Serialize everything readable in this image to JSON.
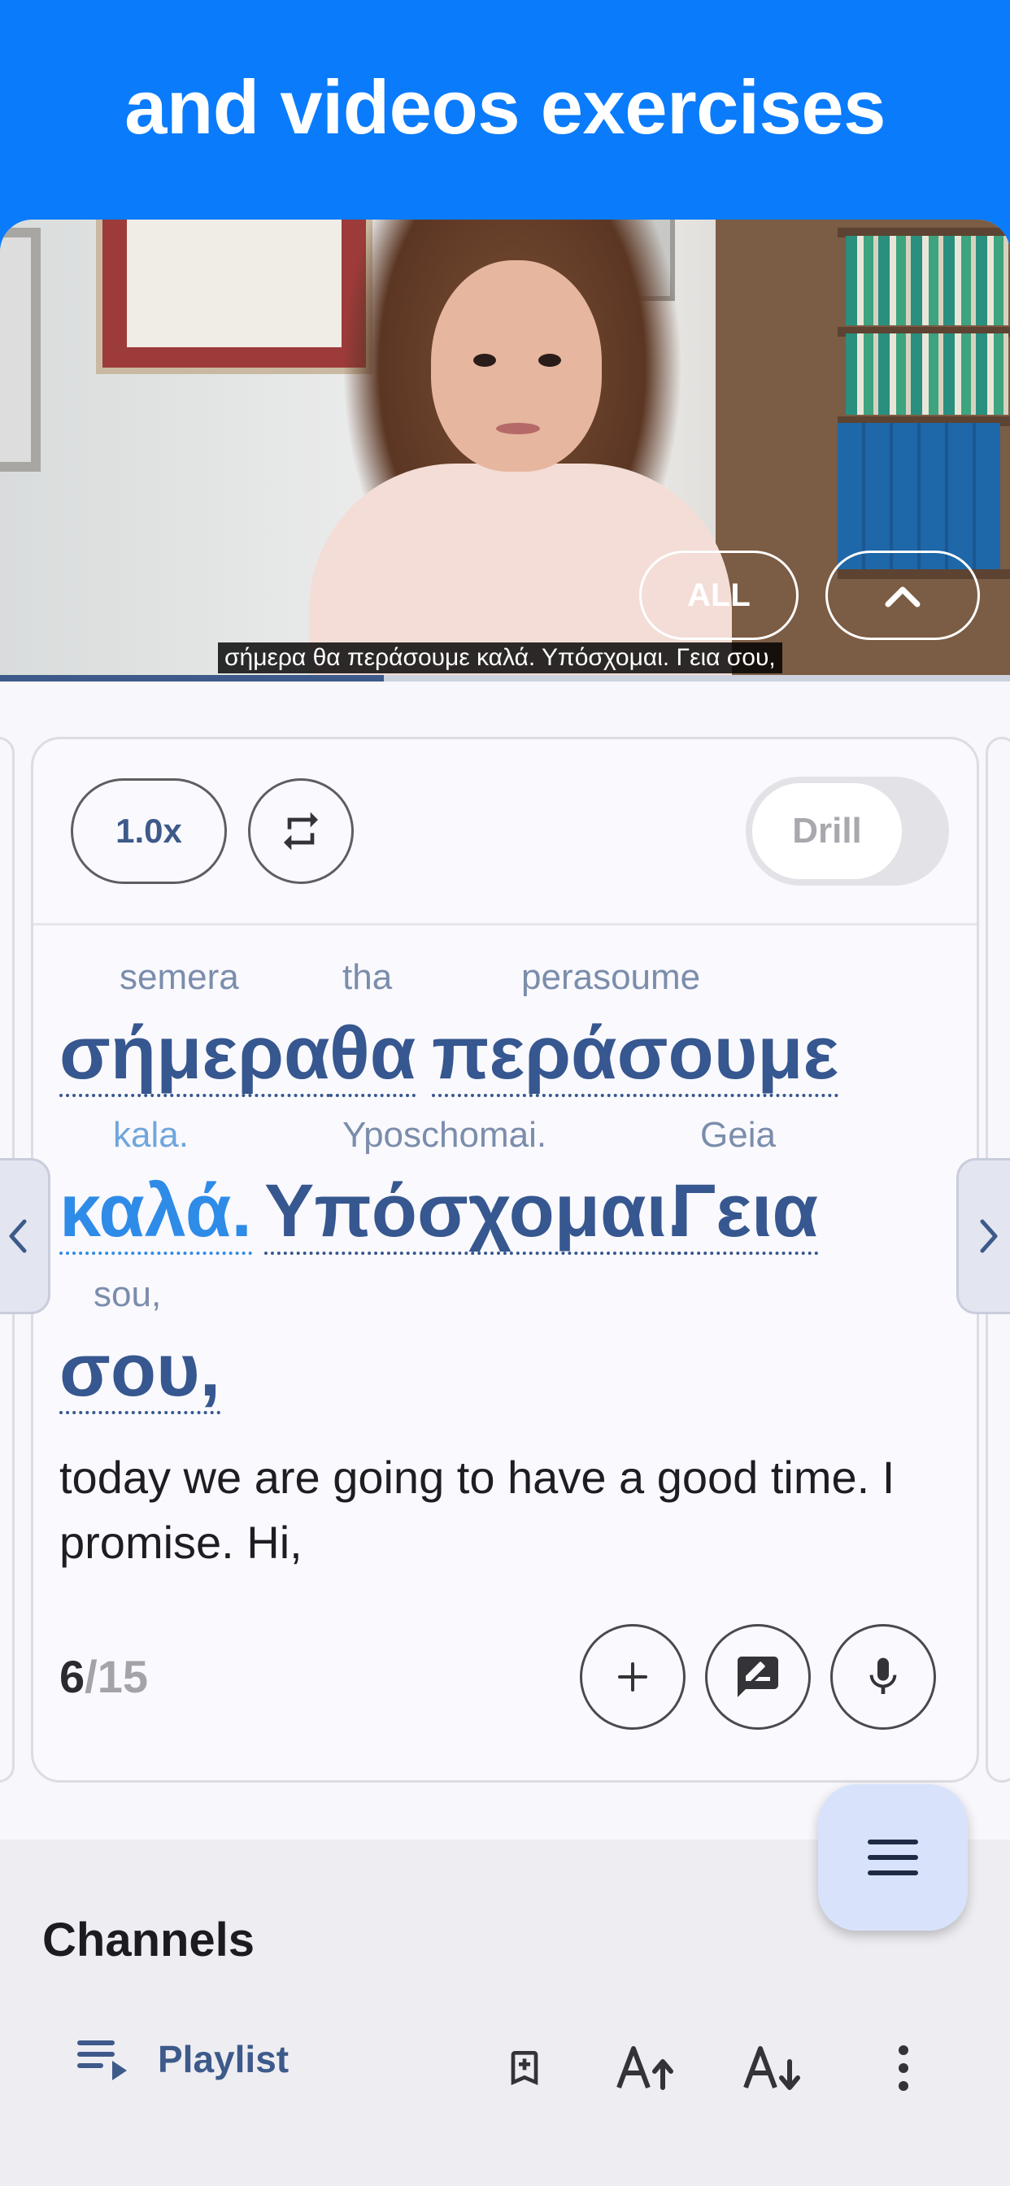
{
  "banner": {
    "title": "and videos exercises"
  },
  "video": {
    "all_label": "ALL",
    "subtitle": "σήμερα θα περάσουμε καλά. Υπόσχομαι. Γεια σου,",
    "progress_fraction": 0.38
  },
  "controls": {
    "speed_label": "1.0x",
    "drill_label": "Drill"
  },
  "lines": [
    {
      "words": [
        {
          "translit": "semera",
          "greek": "σήμερα",
          "highlight": false
        },
        {
          "translit": "tha",
          "greek": "θα",
          "highlight": false
        },
        {
          "translit": "perasoume",
          "greek": "περάσουμε",
          "highlight": false
        }
      ]
    },
    {
      "words": [
        {
          "translit": "kala.",
          "greek": "καλά.",
          "highlight": true
        },
        {
          "translit": "Yposchomai.",
          "greek": "Υπόσχομαι.",
          "highlight": false
        },
        {
          "translit": "Geia",
          "greek": "Γεια",
          "highlight": false
        }
      ]
    },
    {
      "words": [
        {
          "translit": "sou,",
          "greek": "σου,",
          "highlight": false
        }
      ]
    }
  ],
  "translation": "today we are going to have a good time.  I promise.  Hi,",
  "counter": {
    "current": "6",
    "total": "/15"
  },
  "sheet": {
    "title": "Channels",
    "playlist_label": "Playlist"
  },
  "colors": {
    "banner": "#0a7bfb",
    "accent": "#36578f",
    "highlight": "#2f8be8"
  },
  "icons": [
    "repeat-icon",
    "add-icon",
    "feedback-icon",
    "mic-icon",
    "menu-icon",
    "playlist-icon",
    "bookmark-add-icon",
    "font-increase-icon",
    "font-decrease-icon",
    "more-vert-icon",
    "chevron-left-icon",
    "chevron-right-icon",
    "chevron-up-icon"
  ]
}
